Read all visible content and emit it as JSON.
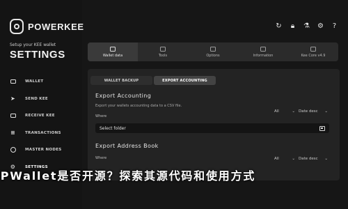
{
  "app": {
    "logo_text": "POWERKEE",
    "subtitle": "Setup your KEE wallet",
    "page_title": "SETTINGS"
  },
  "sidebar": {
    "items": [
      {
        "label": "WALLET",
        "icon": "wallet-icon"
      },
      {
        "label": "SEND KEE",
        "icon": "send-icon"
      },
      {
        "label": "RECEIVE KEE",
        "icon": "receive-icon"
      },
      {
        "label": "TRANSACTIONS",
        "icon": "transactions-icon"
      },
      {
        "label": "MASTER NODES",
        "icon": "masternodes-icon"
      },
      {
        "label": "SETTINGS",
        "icon": "settings-icon"
      }
    ]
  },
  "top_icons": [
    "refresh-icon",
    "lock-icon",
    "flask-icon",
    "gear-icon",
    "question-icon"
  ],
  "tabs": [
    {
      "label": "Wallet data",
      "icon": "wallet-data-icon"
    },
    {
      "label": "Tools",
      "icon": "tools-icon"
    },
    {
      "label": "Options",
      "icon": "options-icon"
    },
    {
      "label": "Information",
      "icon": "information-icon"
    },
    {
      "label": "Kee Core v4.9",
      "icon": "kee-core-icon"
    }
  ],
  "segments": {
    "wallet_backup": "WALLET BACKUP",
    "export_accounting": "EXPORT ACCOUNTING"
  },
  "export_accounting": {
    "title": "Export Accounting",
    "description": "Export your wallets accounting data to a CSV file.",
    "where_label": "Where",
    "filter_value": "All",
    "sort_value": "Date desc",
    "folder_placeholder": "Select folder"
  },
  "export_address_book": {
    "title": "Export Address Book",
    "where_label": "Where",
    "filter_value": "All",
    "sort_value": "Date desc"
  },
  "overlay_text": "TPWallet是否开源？探索其源代码和使用方式",
  "colors": {
    "background": "#161616",
    "panel": "#232323",
    "field": "#141414"
  }
}
